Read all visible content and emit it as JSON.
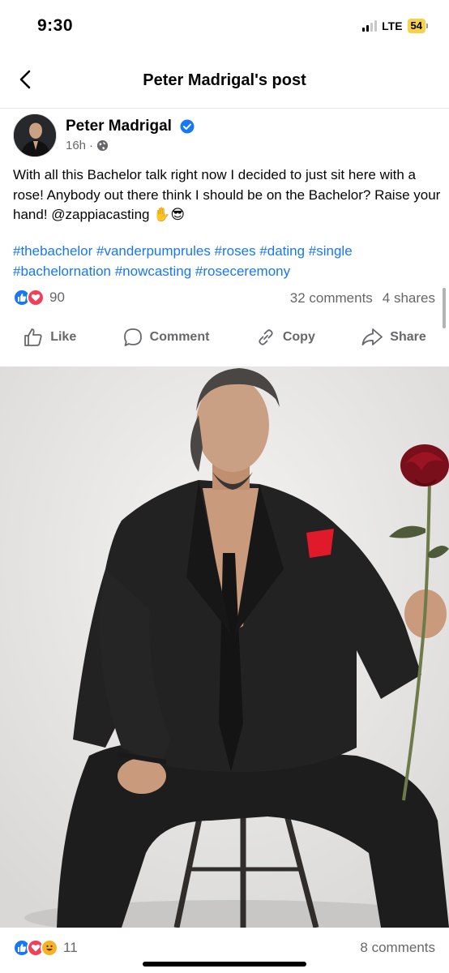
{
  "status_bar": {
    "time": "9:30",
    "network": "LTE",
    "battery": "54"
  },
  "header": {
    "title": "Peter Madrigal's post"
  },
  "post": {
    "author": "Peter Madrigal",
    "time": "16h",
    "dot": "·",
    "text": "With all this Bachelor talk right now I decided to just sit here with a rose! Anybody out there think I should be on the Bachelor?  Raise your hand! @zappiacasting ✋😎",
    "hashtags": "#thebachelor #vanderpumprules #roses #dating #single #bachelornation #nowcasting #roseceremony",
    "reaction_count": "90",
    "comments": "32 comments",
    "shares": "4 shares"
  },
  "actions": {
    "like": "Like",
    "comment": "Comment",
    "copy": "Copy",
    "share": "Share"
  },
  "next_item": {
    "reaction_count": "11",
    "comments": "8 comments"
  },
  "colors": {
    "accent": "#1877f2",
    "love": "#f33e58",
    "muted": "#65676b",
    "battery": "#f7d247"
  }
}
